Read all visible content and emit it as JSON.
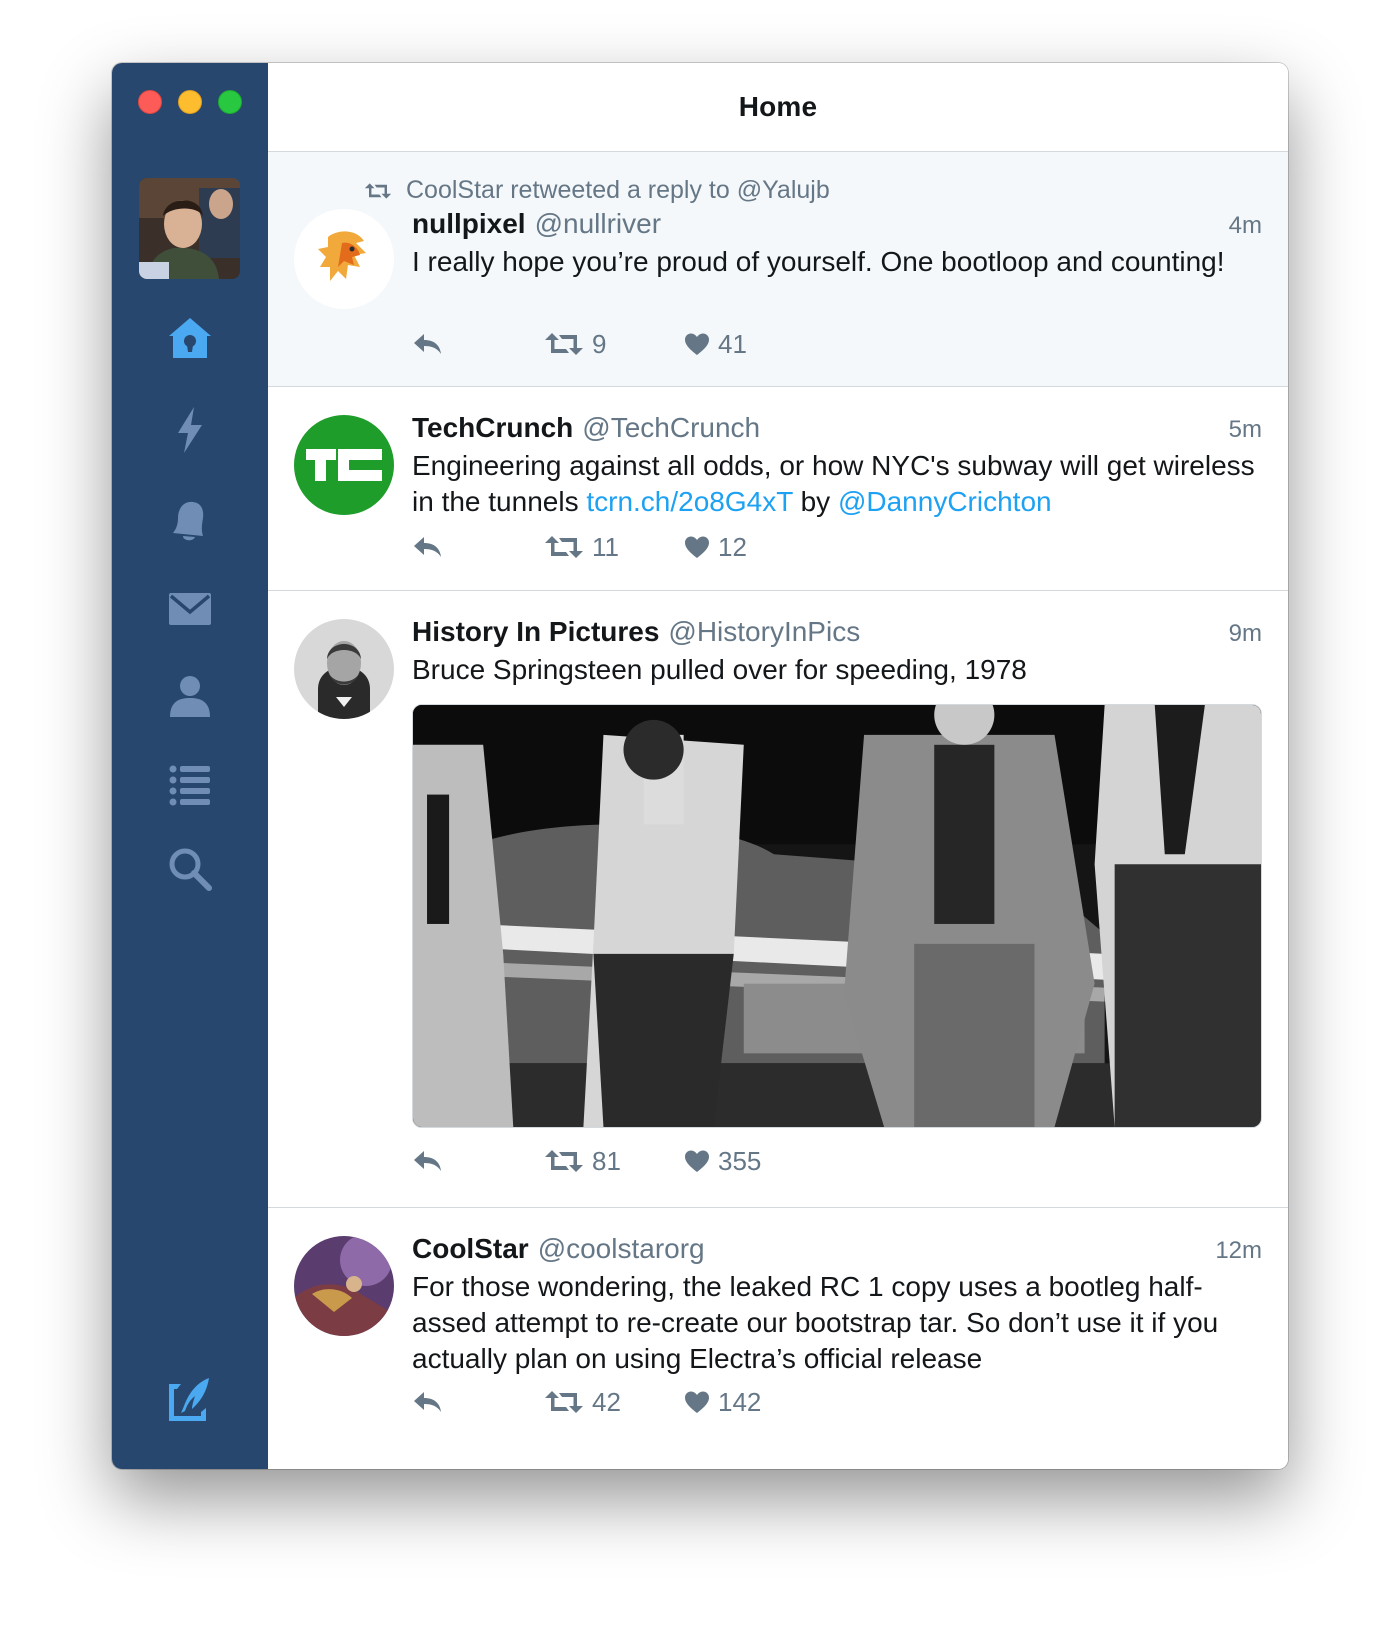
{
  "window": {
    "title": "Home"
  },
  "sidebar": {
    "items": [
      {
        "id": "home",
        "icon": "home-icon",
        "active": true
      },
      {
        "id": "moments",
        "icon": "lightning-icon",
        "active": false
      },
      {
        "id": "notifications",
        "icon": "bell-icon",
        "active": false
      },
      {
        "id": "messages",
        "icon": "envelope-icon",
        "active": false
      },
      {
        "id": "profile",
        "icon": "person-icon",
        "active": false
      },
      {
        "id": "lists",
        "icon": "list-icon",
        "active": false
      },
      {
        "id": "search",
        "icon": "search-icon",
        "active": false
      }
    ],
    "compose_icon": "compose-icon"
  },
  "colors": {
    "sidebar": "#28476e",
    "accent": "#1da1f2",
    "icon_inactive": "#6f8db5",
    "icon_active": "#4aa9f1"
  },
  "tweets": [
    {
      "context": "CoolStar retweeted a reply to @Yalujb",
      "name": "nullpixel",
      "handle": "@nullriver",
      "time": "4m",
      "text": "I really hope you’re proud of yourself. One bootloop and counting!",
      "retweets": "9",
      "likes": "41"
    },
    {
      "name": "TechCrunch",
      "handle": "@TechCrunch",
      "time": "5m",
      "text_before": "Engineering against all odds, or how NYC's subway will get wireless in the tunnels ",
      "link": "tcrn.ch/2o8G4xT",
      "text_mid": " by ",
      "mention": "@DannyCrichton",
      "retweets": "11",
      "likes": "12"
    },
    {
      "name": "History In Pictures",
      "handle": "@HistoryInPics",
      "time": "9m",
      "text": "Bruce Springsteen pulled over for speeding, 1978",
      "retweets": "81",
      "likes": "355"
    },
    {
      "name": "CoolStar",
      "handle": "@coolstarorg",
      "time": "12m",
      "text": "For those wondering, the leaked RC 1 copy uses a bootleg half-assed attempt to re-create our bootstrap tar. So don’t use it if you actually plan on using Electra’s official release",
      "retweets": "42",
      "likes": "142"
    }
  ]
}
